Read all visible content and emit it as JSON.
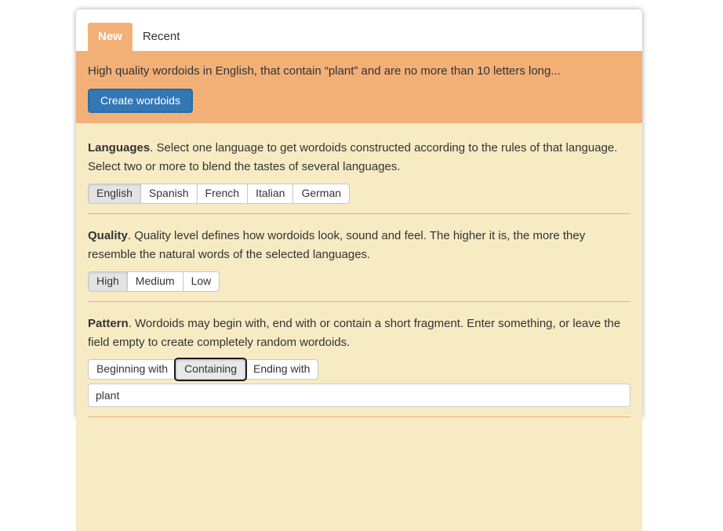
{
  "colors": {
    "accent_orange": "#f2b077",
    "panel_cream": "#f7ebc4",
    "button_blue": "#3377b5",
    "selected_gray": "#e4e4e4",
    "text": "#333333"
  },
  "tabs": [
    {
      "label": "New",
      "active": true
    },
    {
      "label": "Recent",
      "active": false
    }
  ],
  "banner": {
    "summary": "High quality wordoids in English, that contain “plant” and are no more than 10 letters long...",
    "create_button_label": "Create wordoids"
  },
  "sections": {
    "languages": {
      "title": "Languages",
      "description": ". Select one language to get wordoids constructed according to the rules of that language. Select two or more to blend the tastes of several languages.",
      "options": [
        "English",
        "Spanish",
        "French",
        "Italian",
        "German"
      ],
      "selected_option": "English"
    },
    "quality": {
      "title": "Quality",
      "description": ". Quality level defines how wordoids look, sound and feel. The higher it is, the more they resemble the natural words of the selected languages.",
      "options": [
        "High",
        "Medium",
        "Low"
      ],
      "selected_option": "High"
    },
    "pattern": {
      "title": "Pattern",
      "description": ". Wordoids may begin with, end with or contain a short fragment. Enter something, or leave the field empty to create completely random wordoids.",
      "options": [
        "Beginning with",
        "Containing",
        "Ending with"
      ],
      "selected_option": "Containing",
      "input_value": "plant"
    }
  }
}
